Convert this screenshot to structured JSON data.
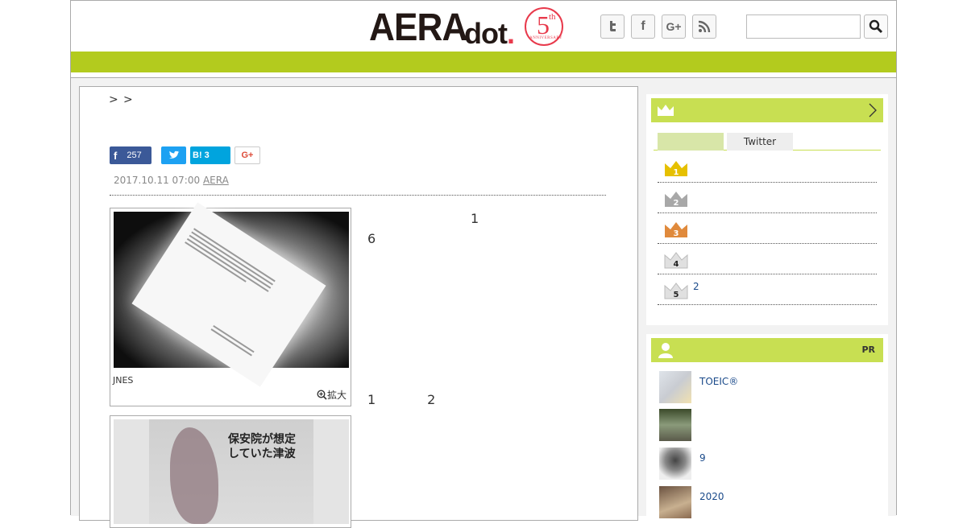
{
  "header": {
    "logo": {
      "aera": "AERA",
      "dot": "dot",
      "dot_mark": ".",
      "number": "5",
      "suffix": "th",
      "anniversary": "ANNIVERSARY"
    },
    "social": [
      {
        "name": "twitter-icon",
        "glyph": "t"
      },
      {
        "name": "facebook-icon",
        "glyph": "f"
      },
      {
        "name": "googleplus-icon",
        "glyph": "G+"
      },
      {
        "name": "rss-icon",
        "glyph": ""
      }
    ],
    "search": {
      "placeholder": "",
      "value": ""
    }
  },
  "breadcrumb": [
    ">",
    ">"
  ],
  "share": {
    "facebook_count": "257",
    "hatena_label": "B!",
    "hatena_count": "3",
    "googleplus_label": "G+"
  },
  "article": {
    "date": "2017.10.11 07:00",
    "source": "AERA",
    "figure1": {
      "caption": "JNES",
      "zoom": "拡大"
    },
    "figure2": {
      "title": "保安院が想定\nしていた津波"
    },
    "body": {
      "p1": "　　　　　　　　1　　　　　　　　　　　6　　　　　　　　　　　　　　　　　　　　　　　　　　　　　　　　　　　　　　　　　　　　　",
      "p2": "　　　　　　\n　　　　　　　　　　　　　　　　　　　　　　　　　　　　　　　　　　　　　　　　　　　　　　　　　　　　　　　　　　　　　　　　　　　　　　　　　　　　　　　　　　　　　　　　　　",
      "link": "　　　　　　　　　　　　　　　　　　　　",
      "p3": "　　　　　　　　　　　　　　　　　　　　　　　　　　　　　　　　　　　　　　　　　　　1　　　　2　　　"
    }
  },
  "ranking": {
    "tabs": [
      "",
      "Twitter"
    ],
    "items": [
      {
        "rank": "1",
        "text": "",
        "color": "#e6c000"
      },
      {
        "rank": "2",
        "text": "",
        "color": "#a8a8a8"
      },
      {
        "rank": "3",
        "text": "",
        "color": "#e08a3c"
      },
      {
        "rank": "4",
        "text": "",
        "color": "#e0e0e0"
      },
      {
        "rank": "5",
        "text": "2",
        "color": "#e0e0e0"
      }
    ]
  },
  "pr": {
    "label": "PR",
    "items": [
      {
        "text": "TOEIC®"
      },
      {
        "text": ""
      },
      {
        "text": "9"
      },
      {
        "text": "2020"
      }
    ]
  },
  "colors": {
    "accent": "#b3cb1e",
    "sidebar_head": "#c8df52",
    "link": "#1a4a8a"
  }
}
